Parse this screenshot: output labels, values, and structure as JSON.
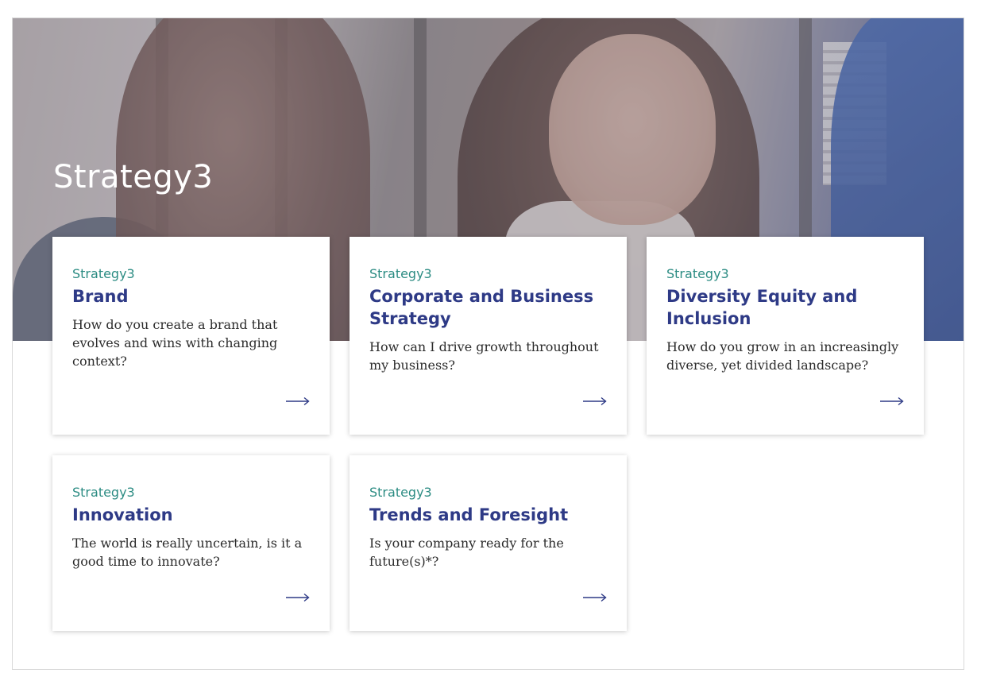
{
  "hero": {
    "title": "Strategy3"
  },
  "cards": [
    {
      "eyebrow": "Strategy3",
      "title": "Brand",
      "description": "How do you create a brand that evolves and wins with changing context?",
      "arrow_icon": "arrow-right-icon"
    },
    {
      "eyebrow": "Strategy3",
      "title": "Corporate and Business Strategy",
      "description": "How can I drive growth throughout my business?",
      "arrow_icon": "arrow-right-icon"
    },
    {
      "eyebrow": "Strategy3",
      "title": "Diversity Equity and Inclusion",
      "description": "How do you grow in an increasingly diverse, yet divided landscape?",
      "arrow_icon": "arrow-right-icon"
    },
    {
      "eyebrow": "Strategy3",
      "title": "Innovation",
      "description": "The world is really uncertain, is it a good time to innovate?",
      "arrow_icon": "arrow-right-icon"
    },
    {
      "eyebrow": "Strategy3",
      "title": "Trends and Foresight",
      "description": "Is your company ready for the future(s)*?",
      "arrow_icon": "arrow-right-icon"
    }
  ],
  "colors": {
    "eyebrow": "#2c8c83",
    "title": "#2e3a86",
    "body": "#2b2b2b",
    "arrow": "#2e3a86"
  }
}
